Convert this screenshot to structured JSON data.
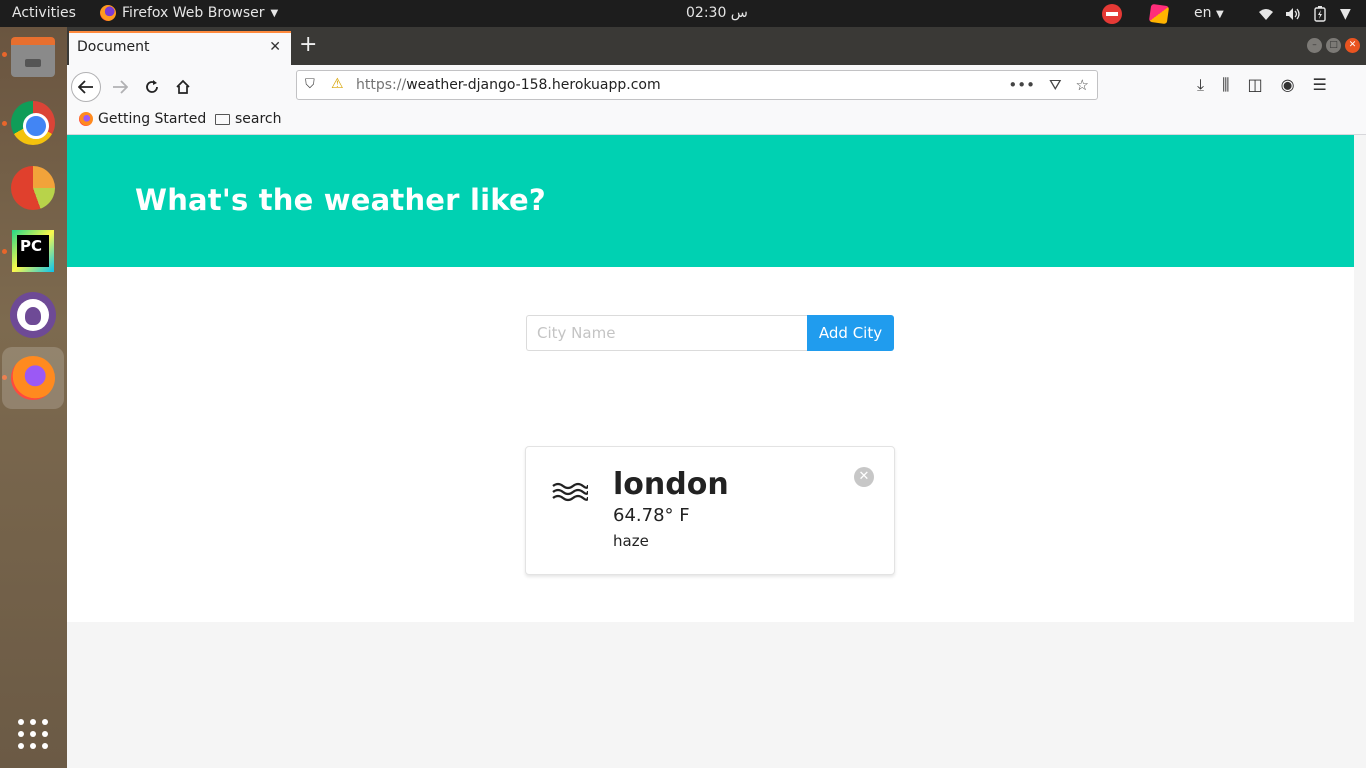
{
  "system": {
    "activities": "Activities",
    "app_name": "Firefox Web Browser",
    "clock": "02:30 س",
    "language": "en"
  },
  "browser": {
    "tab_title": "Document",
    "url_protocol": "https://",
    "url_host": "weather-django-158.herokuapp.com",
    "bookmarks": [
      {
        "label": "Getting Started",
        "icon": "firefox-icon"
      },
      {
        "label": "search",
        "icon": "folder-icon"
      }
    ]
  },
  "page": {
    "hero_title": "What's the weather like?",
    "city_input": {
      "placeholder": "City Name",
      "value": ""
    },
    "add_button": "Add City",
    "colors": {
      "hero": "#00d1b2",
      "button": "#209cee"
    },
    "cities": [
      {
        "name": "london",
        "temperature": "64.78° F",
        "description": "haze",
        "icon": "haze-icon"
      }
    ]
  }
}
